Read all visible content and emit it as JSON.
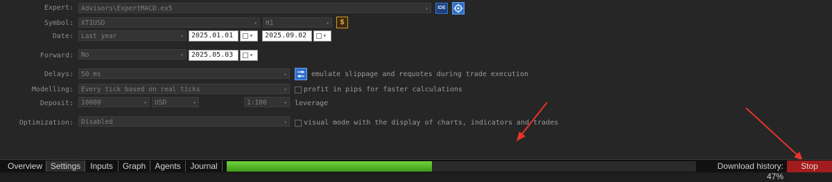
{
  "settings": {
    "expert": {
      "label": "Expert:",
      "value": "Advisors\\ExpertMACD.ex5"
    },
    "symbol": {
      "label": "Symbol:",
      "value": "XTIUSD",
      "timeframe": "H1"
    },
    "date": {
      "label": "Date:",
      "value": "Last year",
      "from": "2025.01.01",
      "to": "2025.09.02"
    },
    "forward": {
      "label": "Forward:",
      "value": "No",
      "date": "2025.05.03"
    },
    "delays": {
      "label": "Delays:",
      "value": "50 ms",
      "option_text": "emulate slippage and requotes during trade execution"
    },
    "modelling": {
      "label": "Modelling:",
      "value": "Every tick based on real ticks",
      "option_text": "profit in pips for faster calculations"
    },
    "deposit": {
      "label": "Deposit:",
      "value": "10000",
      "currency": "USD",
      "leverage": "1:100",
      "leverage_label": "leverage"
    },
    "optimization": {
      "label": "Optimization:",
      "value": "Disabled",
      "option_text": "visual mode with the display of charts, indicators and trades"
    },
    "ide_icon_text": "IDE"
  },
  "tabs": [
    "Overview",
    "Settings",
    "Inputs",
    "Graph",
    "Agents",
    "Journal"
  ],
  "active_tab": "Settings",
  "progress": {
    "fraction": 0.47
  },
  "status_text": "Download history: 47%",
  "stop_label": "Stop",
  "colors": {
    "accent_blue": "#2f6fc8",
    "annotation_red": "#e8342a",
    "progress_green": "#5cc42f",
    "stop_red": "#a11d1d"
  }
}
